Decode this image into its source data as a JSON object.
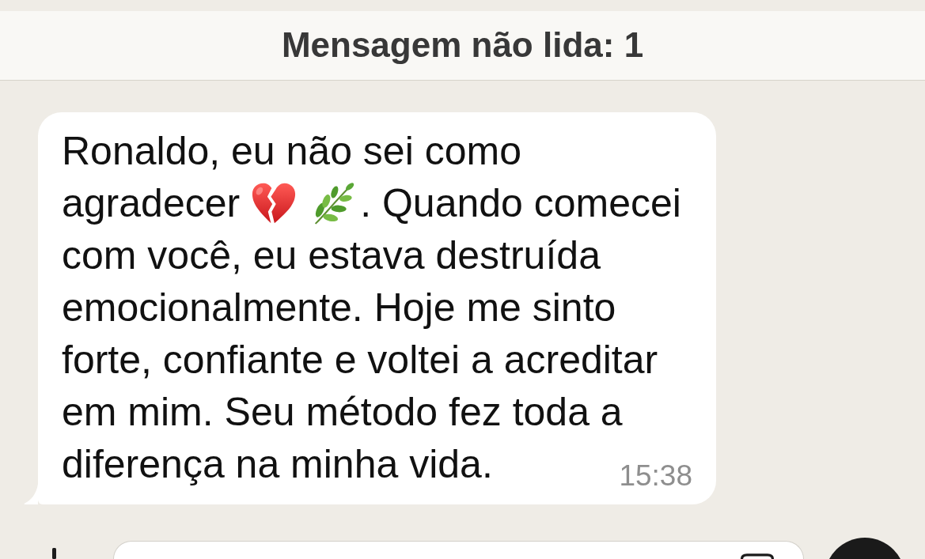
{
  "unread_banner": {
    "text": "Mensagem não lida: 1"
  },
  "message": {
    "lines": [
      [
        {
          "kind": "text",
          "text": "Ronaldo, eu não sei como"
        }
      ],
      [
        {
          "kind": "text",
          "text": "agradecer"
        },
        {
          "kind": "broken_heart"
        },
        {
          "kind": "herb"
        },
        {
          "kind": "text",
          "text": ". Quando comecei"
        }
      ],
      [
        {
          "kind": "text",
          "text": "com você, eu estava destruída"
        }
      ],
      [
        {
          "kind": "text",
          "text": "emocionalmente. Hoje me sinto"
        }
      ],
      [
        {
          "kind": "text",
          "text": "forte, confiante e voltei a acreditar"
        }
      ],
      [
        {
          "kind": "text",
          "text": "em mim. Seu método fez toda a"
        }
      ],
      [
        {
          "kind": "text",
          "text": "diferença na minha vida."
        }
      ]
    ],
    "time": "15:38"
  }
}
